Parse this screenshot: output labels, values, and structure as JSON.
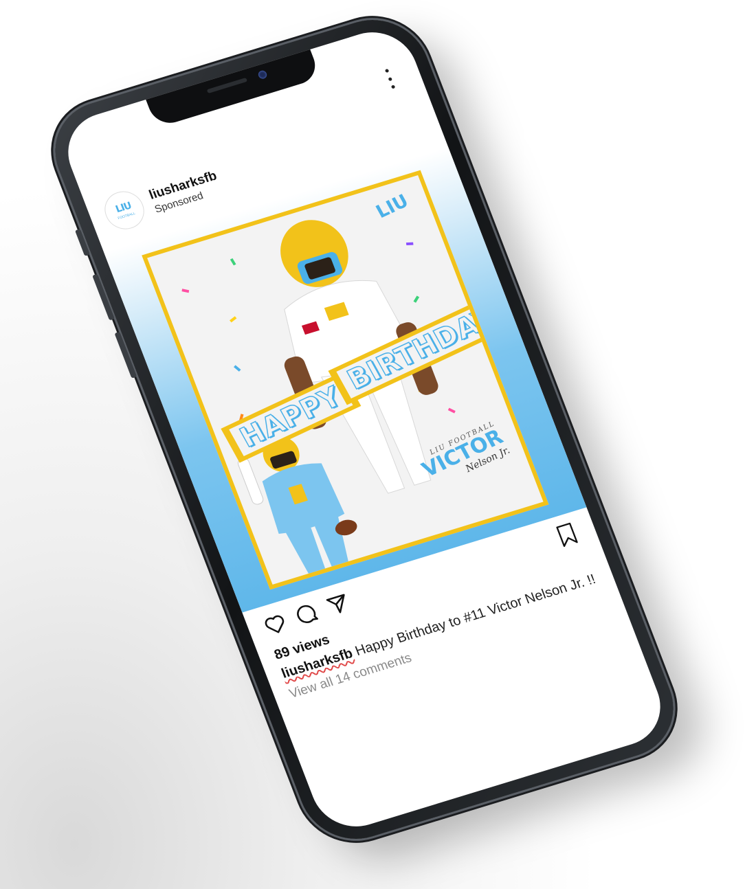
{
  "header": {
    "username": "liusharksfb",
    "subtitle": "Sponsored",
    "avatar": {
      "letters": "LIU",
      "sub": "FOOTBALL"
    }
  },
  "post_image": {
    "logo": "LIU",
    "banner_left": "HAPPY",
    "banner_right": "BIRTHDAY",
    "name_kicker": "LIU FOOTBALL",
    "name_first": "VICTOR",
    "name_last": "Nelson Jr."
  },
  "actions": {
    "like_icon": "heart-icon",
    "comment_icon": "comment-icon",
    "share_icon": "send-icon",
    "save_icon": "bookmark-icon",
    "more_icon": "more-vertical-icon"
  },
  "meta": {
    "views": "89 views",
    "caption_user": "liusharksfb",
    "caption_text": "Happy Birthday to #11 Victor Nelson Jr. !!",
    "comments_link": "View all 14 comments"
  },
  "colors": {
    "accent_blue": "#4ab0e8",
    "accent_yellow": "#f2c21a",
    "phone_frame": "#121416"
  }
}
